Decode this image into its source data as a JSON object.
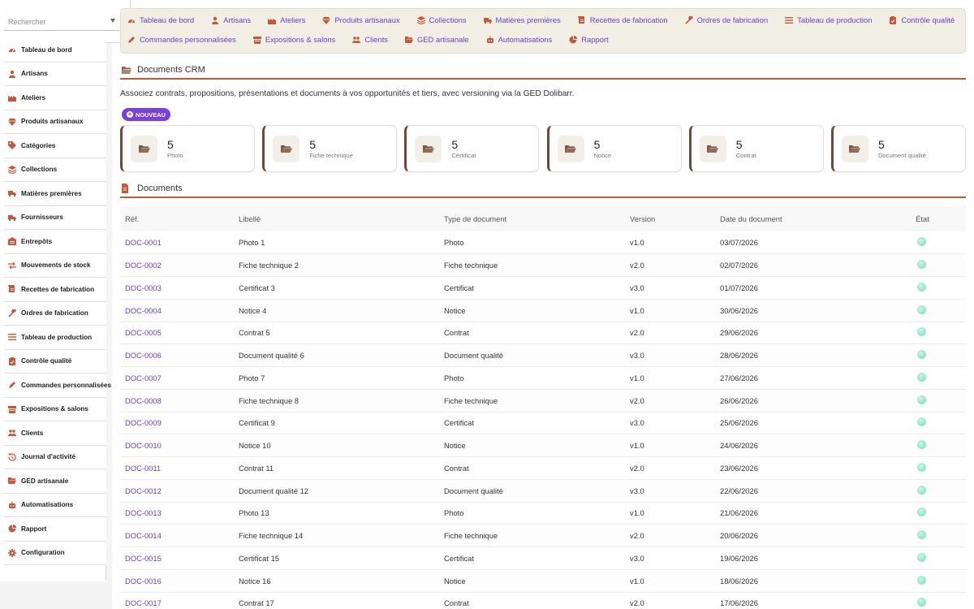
{
  "sidebar": {
    "search_placeholder": "Rechercher",
    "items": [
      {
        "label": "Tableau de bord",
        "icon": "gauge-icon"
      },
      {
        "label": "Artisans",
        "icon": "user-icon"
      },
      {
        "label": "Ateliers",
        "icon": "factory-icon"
      },
      {
        "label": "Produits artisanaux",
        "icon": "gem-icon"
      },
      {
        "label": "Catégories",
        "icon": "tags-icon"
      },
      {
        "label": "Collections",
        "icon": "layers-icon"
      },
      {
        "label": "Matières premières",
        "icon": "truck-icon"
      },
      {
        "label": "Fournisseurs",
        "icon": "truck-icon"
      },
      {
        "label": "Entrepôts",
        "icon": "warehouse-icon"
      },
      {
        "label": "Mouvements de stock",
        "icon": "exchange-icon"
      },
      {
        "label": "Recettes de fabrication",
        "icon": "scroll-icon"
      },
      {
        "label": "Ordres de fabrication",
        "icon": "hammer-icon"
      },
      {
        "label": "Tableau de production",
        "icon": "list-icon"
      },
      {
        "label": "Contrôle qualité",
        "icon": "clipboard-check-icon"
      },
      {
        "label": "Commandes personnalisées",
        "icon": "pencil-icon"
      },
      {
        "label": "Expositions & salons",
        "icon": "store-icon"
      },
      {
        "label": "Clients",
        "icon": "users-icon"
      },
      {
        "label": "Journal d'activité",
        "icon": "history-icon"
      },
      {
        "label": "GED artisanale",
        "icon": "folder-open-icon"
      },
      {
        "label": "Automatisations",
        "icon": "robot-icon"
      },
      {
        "label": "Rapport",
        "icon": "pie-chart-icon"
      },
      {
        "label": "Configuration",
        "icon": "gear-icon"
      }
    ]
  },
  "topnav": {
    "row1": [
      {
        "label": "Tableau de bord",
        "icon": "gauge-icon"
      },
      {
        "label": "Artisans",
        "icon": "user-icon"
      },
      {
        "label": "Ateliers",
        "icon": "factory-icon"
      },
      {
        "label": "Produits artisanaux",
        "icon": "gem-icon"
      },
      {
        "label": "Collections",
        "icon": "layers-icon"
      },
      {
        "label": "Matières premières",
        "icon": "truck-icon"
      },
      {
        "label": "Recettes de fabrication",
        "icon": "scroll-icon"
      },
      {
        "label": "Ordres de fabrication",
        "icon": "hammer-icon"
      },
      {
        "label": "Tableau de production",
        "icon": "list-icon"
      },
      {
        "label": "Contrôle qualité",
        "icon": "clipboard-check-icon"
      }
    ],
    "row2": [
      {
        "label": "Commandes personnalisées",
        "icon": "pencil-icon"
      },
      {
        "label": "Expositions & salons",
        "icon": "store-icon"
      },
      {
        "label": "Clients",
        "icon": "users-icon"
      },
      {
        "label": "GED artisanale",
        "icon": "folder-open-icon"
      },
      {
        "label": "Automatisations",
        "icon": "robot-icon"
      },
      {
        "label": "Rapport",
        "icon": "pie-chart-icon"
      }
    ]
  },
  "page": {
    "title": "Documents CRM",
    "description": "Associez contrats, propositions, présentations et documents à vos opportunités et tiers, avec versioning via la GED Dolibarr.",
    "new_button": "NOUVEAU",
    "documents_title": "Documents"
  },
  "cards": [
    {
      "count": "5",
      "label": "Photo"
    },
    {
      "count": "5",
      "label": "Fiche technique"
    },
    {
      "count": "5",
      "label": "Certificat"
    },
    {
      "count": "5",
      "label": "Notice"
    },
    {
      "count": "5",
      "label": "Contrat"
    },
    {
      "count": "5",
      "label": "Document qualité"
    }
  ],
  "table": {
    "headers": {
      "ref": "Réf.",
      "label": "Libellé",
      "type": "Type de document",
      "version": "Version",
      "date": "Date du document",
      "state": "État"
    },
    "rows": [
      {
        "ref": "DOC-0001",
        "label": "Photo 1",
        "type": "Photo",
        "version": "v1.0",
        "date": "03/07/2026"
      },
      {
        "ref": "DOC-0002",
        "label": "Fiche technique 2",
        "type": "Fiche technique",
        "version": "v2.0",
        "date": "02/07/2026"
      },
      {
        "ref": "DOC-0003",
        "label": "Certificat 3",
        "type": "Certificat",
        "version": "v3.0",
        "date": "01/07/2026"
      },
      {
        "ref": "DOC-0004",
        "label": "Notice 4",
        "type": "Notice",
        "version": "v1.0",
        "date": "30/06/2026"
      },
      {
        "ref": "DOC-0005",
        "label": "Contrat 5",
        "type": "Contrat",
        "version": "v2.0",
        "date": "29/06/2026"
      },
      {
        "ref": "DOC-0006",
        "label": "Document qualité 6",
        "type": "Document qualité",
        "version": "v3.0",
        "date": "28/06/2026"
      },
      {
        "ref": "DOC-0007",
        "label": "Photo 7",
        "type": "Photo",
        "version": "v1.0",
        "date": "27/06/2026"
      },
      {
        "ref": "DOC-0008",
        "label": "Fiche technique 8",
        "type": "Fiche technique",
        "version": "v2.0",
        "date": "26/06/2026"
      },
      {
        "ref": "DOC-0009",
        "label": "Certificat 9",
        "type": "Certificat",
        "version": "v3.0",
        "date": "25/06/2026"
      },
      {
        "ref": "DOC-0010",
        "label": "Notice 10",
        "type": "Notice",
        "version": "v1.0",
        "date": "24/06/2026"
      },
      {
        "ref": "DOC-0011",
        "label": "Contrat 11",
        "type": "Contrat",
        "version": "v2.0",
        "date": "23/06/2026"
      },
      {
        "ref": "DOC-0012",
        "label": "Document qualité 12",
        "type": "Document qualité",
        "version": "v3.0",
        "date": "22/06/2026"
      },
      {
        "ref": "DOC-0013",
        "label": "Photo 13",
        "type": "Photo",
        "version": "v1.0",
        "date": "21/06/2026"
      },
      {
        "ref": "DOC-0014",
        "label": "Fiche technique 14",
        "type": "Fiche technique",
        "version": "v2.0",
        "date": "20/06/2026"
      },
      {
        "ref": "DOC-0015",
        "label": "Certificat 15",
        "type": "Certificat",
        "version": "v3.0",
        "date": "19/06/2026"
      },
      {
        "ref": "DOC-0016",
        "label": "Notice 16",
        "type": "Notice",
        "version": "v1.0",
        "date": "18/06/2026"
      },
      {
        "ref": "DOC-0017",
        "label": "Contrat 17",
        "type": "Contrat",
        "version": "v2.0",
        "date": "17/06/2026"
      }
    ]
  },
  "colors": {
    "accent_link": "#6b3fd6",
    "icon_brown": "#c8573a",
    "nav_bg": "#f1eee3",
    "button_purple": "#7a3fe4",
    "status_green": "#6fe0b8"
  }
}
